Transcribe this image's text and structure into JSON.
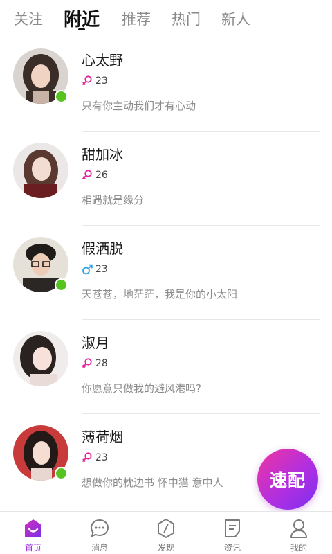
{
  "tabs": [
    {
      "label": "关注",
      "active": false
    },
    {
      "label": "附近",
      "active": true
    },
    {
      "label": "推荐",
      "active": false
    },
    {
      "label": "热门",
      "active": false
    },
    {
      "label": "新人",
      "active": false
    }
  ],
  "users": [
    {
      "name": "心太野",
      "gender": "female",
      "gender_icon": "female-icon",
      "age": "23",
      "signature": "只有你主动我们才有心动",
      "online": true
    },
    {
      "name": "甜加冰",
      "gender": "female",
      "gender_icon": "female-icon",
      "age": "26",
      "signature": "相遇就是缘分",
      "online": false
    },
    {
      "name": "假洒脱",
      "gender": "male",
      "gender_icon": "male-icon",
      "age": "23",
      "signature": "天苍苍，地茫茫，我是你的小太阳",
      "online": true
    },
    {
      "name": "淑月",
      "gender": "female",
      "gender_icon": "female-icon",
      "age": "28",
      "signature": "你愿意只做我的避风港吗?",
      "online": false
    },
    {
      "name": "薄荷烟",
      "gender": "female",
      "gender_icon": "female-icon",
      "age": "23",
      "signature": "想做你的枕边书 怀中猫 意中人",
      "online": true
    }
  ],
  "fab": {
    "label": "速配"
  },
  "nav": [
    {
      "label": "首页",
      "icon": "home-icon",
      "active": true
    },
    {
      "label": "消息",
      "icon": "message-icon",
      "active": false
    },
    {
      "label": "发现",
      "icon": "discover-icon",
      "active": false
    },
    {
      "label": "资讯",
      "icon": "news-icon",
      "active": false
    },
    {
      "label": "我的",
      "icon": "profile-icon",
      "active": false
    }
  ],
  "colors": {
    "accent": "#9b30d9",
    "female": "#e0249a",
    "male": "#2aa3e6",
    "online": "#57c31f"
  }
}
